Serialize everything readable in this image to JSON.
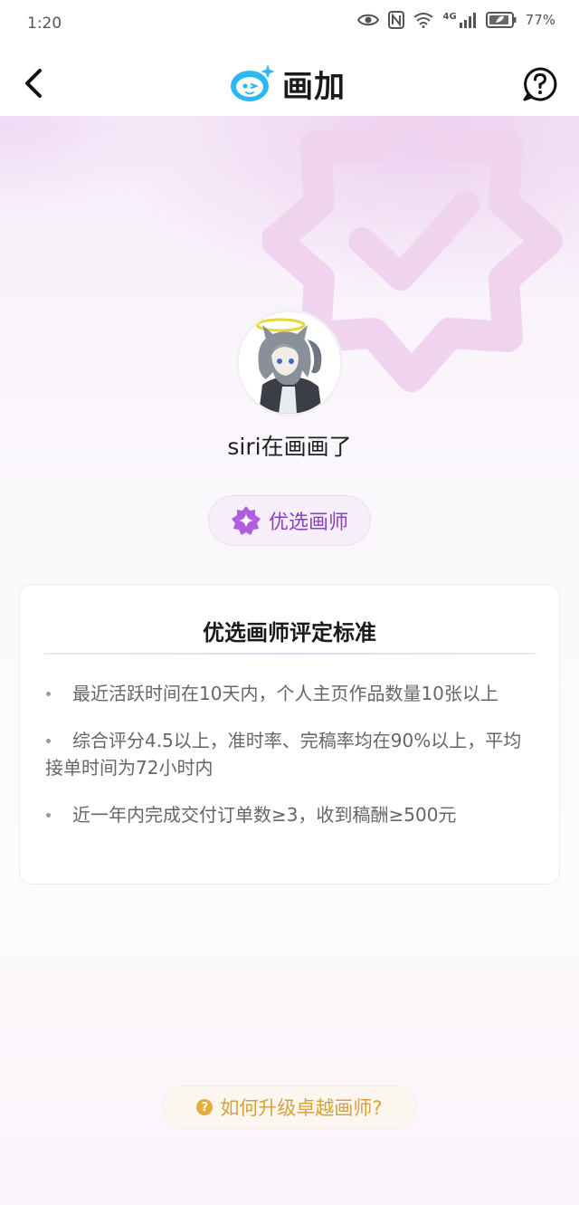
{
  "status_bar": {
    "time": "1:20",
    "battery_percent": "77%",
    "network_label": "4G",
    "icons": [
      "eye-icon",
      "nfc-icon",
      "wifi-icon",
      "signal-icon",
      "battery-icon"
    ]
  },
  "header": {
    "brand_name": "画加",
    "back_icon": "chevron-left-icon",
    "help_icon": "question-circle-icon"
  },
  "profile": {
    "username": "siri在画画了",
    "badge_label": "优选画师"
  },
  "criteria_card": {
    "title": "优选画师评定标准",
    "items": [
      "最近活跃时间在10天内，个人主页作品数量10张以上",
      "综合评分4.5以上，准时率、完稿率均在90%以上，平均接单时间为72小时内",
      "近一年内完成交付订单数≥3，收到稿酬≥500元"
    ]
  },
  "upgrade": {
    "icon_glyph": "?",
    "label": "如何升级卓越画师?"
  },
  "colors": {
    "brand_blue": "#2bb8f0",
    "badge_purple": "#8a3fc4",
    "upgrade_gold": "#d8a23a"
  }
}
